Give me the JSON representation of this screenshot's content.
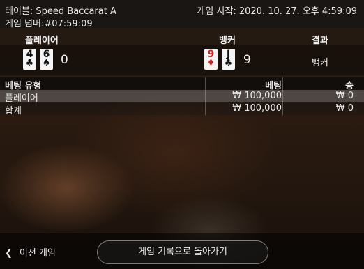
{
  "header": {
    "table_label": "테이블: Speed Baccarat A",
    "game_number": "게임 넘버:#07:59:09",
    "game_start": "게임 시작: 2020. 10. 27. 오후 4:59:09"
  },
  "result": {
    "player_label": "플레이어",
    "banker_label": "뱅커",
    "result_label": "결과",
    "player_cards": [
      {
        "rank": "4",
        "suit": "♣",
        "color": "black"
      },
      {
        "rank": "6",
        "suit": "♠",
        "color": "black"
      }
    ],
    "player_score": "0",
    "banker_cards": [
      {
        "rank": "9",
        "suit": "♦",
        "color": "red"
      },
      {
        "rank": "J",
        "suit": "♣",
        "color": "black"
      }
    ],
    "banker_score": "9",
    "outcome": "뱅커"
  },
  "bets": {
    "headers": {
      "type": "베팅 유형",
      "bet": "베팅",
      "win": "승"
    },
    "rows": [
      {
        "type": "플레이어",
        "bet": "₩ 100,000",
        "win": "₩ 0"
      },
      {
        "type": "합계",
        "bet": "₩ 100,000",
        "win": "₩ 0"
      }
    ]
  },
  "footer": {
    "prev_label": "이전 게임",
    "back_label": "게임 기록으로 돌아가기"
  },
  "colors": {
    "card_red": "#d0231f",
    "card_black": "#111111"
  }
}
